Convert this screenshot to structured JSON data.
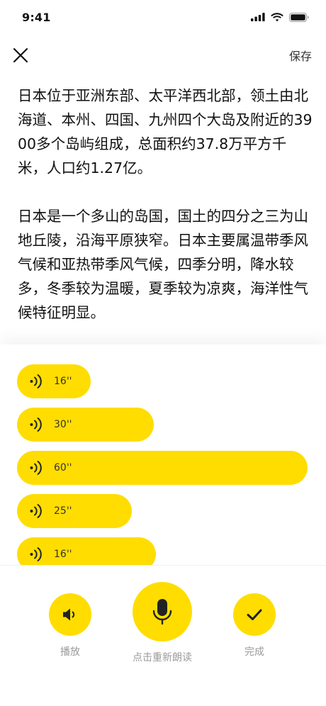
{
  "status_bar": {
    "time": "9:41"
  },
  "nav": {
    "save_label": "保存"
  },
  "content": {
    "paragraphs": [
      "日本位于亚洲东部、太平洋西北部，领土由北海道、本州、四国、九州四个大岛及附近的3900多个岛屿组成，总面积约37.8万平方千米，人口约1.27亿。",
      "日本是一个多山的岛国，国土的四分之三为山地丘陵，沿海平原狭窄。日本主要属温带季风气候和亚热带季风气候，四季分明，降水较多，冬季较为温暖，夏季较为凉爽，海洋性气候特征明显。"
    ]
  },
  "recordings": [
    {
      "duration": "16''"
    },
    {
      "duration": "30''"
    },
    {
      "duration": "60''"
    },
    {
      "duration": "25''"
    },
    {
      "duration": "16''"
    }
  ],
  "controls": {
    "play_label": "播放",
    "rerecord_label": "点击重新朗读",
    "done_label": "完成"
  },
  "colors": {
    "accent": "#FFDD00",
    "text": "#111111",
    "muted": "#9a9a9a"
  },
  "icons": [
    "close-icon",
    "speaker-icon",
    "microphone-icon",
    "checkmark-icon",
    "audio-wave-icon"
  ]
}
